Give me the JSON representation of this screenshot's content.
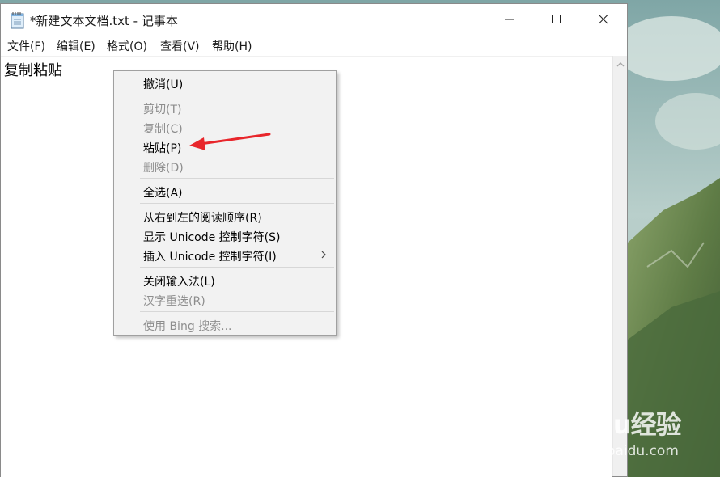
{
  "window": {
    "title": "*新建文本文档.txt - 记事本",
    "minimize_icon": "minimize-icon",
    "maximize_icon": "maximize-icon",
    "close_icon": "close-icon"
  },
  "menubar": {
    "items": [
      "文件(F)",
      "编辑(E)",
      "格式(O)",
      "查看(V)",
      "帮助(H)"
    ]
  },
  "editor": {
    "text": "复制粘贴"
  },
  "context_menu": {
    "items": [
      {
        "label": "撤消(U)",
        "enabled": true
      },
      {
        "label": "剪切(T)",
        "enabled": false
      },
      {
        "label": "复制(C)",
        "enabled": false
      },
      {
        "label": "粘贴(P)",
        "enabled": true
      },
      {
        "label": "删除(D)",
        "enabled": false
      },
      {
        "label": "全选(A)",
        "enabled": true
      },
      {
        "label": "从右到左的阅读顺序(R)",
        "enabled": true
      },
      {
        "label": "显示 Unicode 控制字符(S)",
        "enabled": true
      },
      {
        "label": "插入 Unicode 控制字符(I)",
        "enabled": true,
        "has_submenu": true
      },
      {
        "label": "关闭输入法(L)",
        "enabled": true
      },
      {
        "label": "汉字重选(R)",
        "enabled": false
      },
      {
        "label": "使用 Bing 搜索...",
        "enabled": false
      }
    ]
  },
  "annotation": {
    "arrow_color": "#e8262b"
  },
  "watermark": {
    "brand": "Baidu经验",
    "url": "jingyan.baidu.com"
  }
}
